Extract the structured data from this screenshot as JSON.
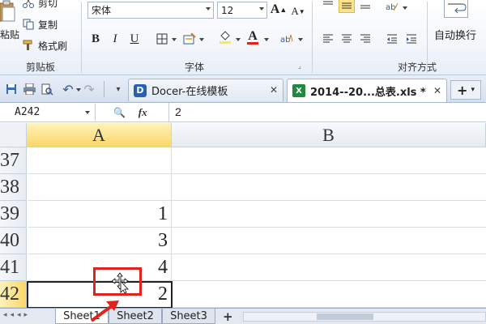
{
  "ribbon": {
    "clipboard": {
      "paste": "粘贴",
      "cut": "剪切",
      "copy": "复制",
      "format_painter": "格式刷",
      "label": "剪贴板"
    },
    "font": {
      "font_name": "宋体",
      "font_size": "12",
      "grow": "A",
      "shrink": "A",
      "bold": "B",
      "italic": "I",
      "underline": "U",
      "font_color_letter": "A",
      "label": "字体"
    },
    "alignment": {
      "wrap_text": "自动换行",
      "label": "对齐方式"
    }
  },
  "tabs": [
    {
      "label": "Docer-在线模板",
      "active": false
    },
    {
      "label": "2014--20...总表.xls *",
      "active": true
    }
  ],
  "tab_add": "+",
  "formula_bar": {
    "name_box": "A242",
    "fx": "fx",
    "value": "2"
  },
  "grid": {
    "columns": [
      "A",
      "B"
    ],
    "selected_column": "A",
    "rows": [
      {
        "num": "37",
        "a": ""
      },
      {
        "num": "38",
        "a": ""
      },
      {
        "num": "39",
        "a": "1"
      },
      {
        "num": "40",
        "a": "3"
      },
      {
        "num": "41",
        "a": "4"
      },
      {
        "num": "42",
        "a": "2",
        "selected": true
      }
    ]
  },
  "sheets": [
    "Sheet1",
    "Sheet2",
    "Sheet3"
  ],
  "sheet_add": "+",
  "colors": {
    "selected_header": "#f9d767",
    "annotation_red": "#e0231c",
    "excel_green": "#1f8a3c",
    "docer_blue": "#2a5fb2"
  }
}
